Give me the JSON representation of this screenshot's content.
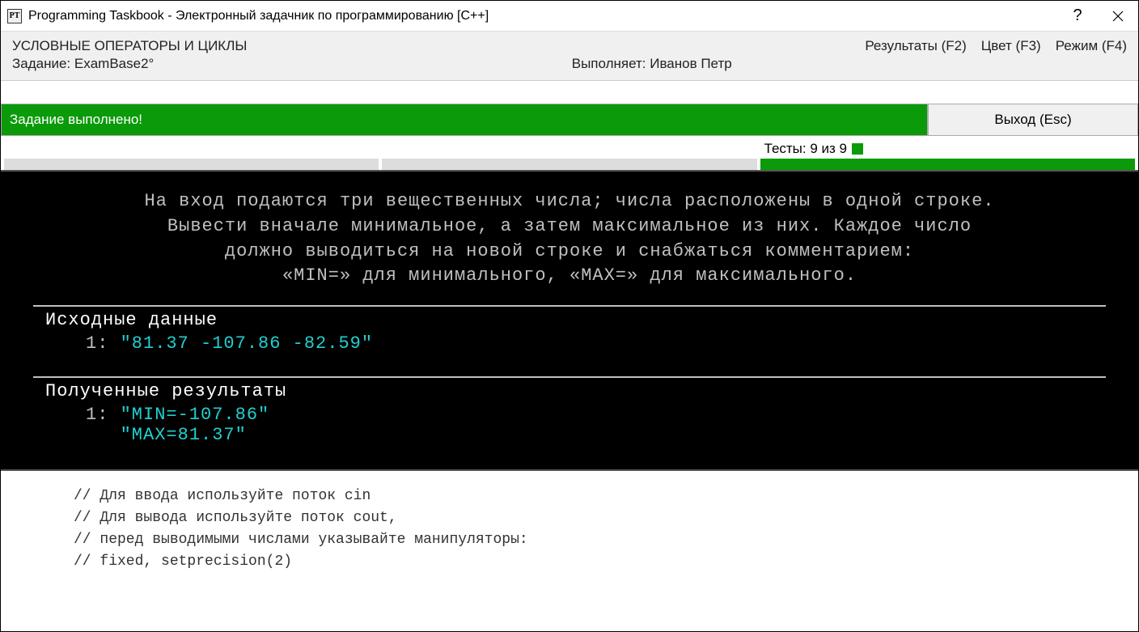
{
  "titlebar": {
    "icon_text": "PT",
    "title": "Programming Taskbook - Электронный задачник по программированию [C++]",
    "help": "?"
  },
  "info": {
    "caption": "УСЛОВНЫЕ ОПЕРАТОРЫ И ЦИКЛЫ",
    "task_label": "Задание: ExamBase2°",
    "user_label": "Выполняет: Иванов Петр"
  },
  "menu": {
    "results": "Результаты (F2)",
    "color": "Цвет (F3)",
    "mode": "Режим (F4)"
  },
  "status": {
    "message": "Задание выполнено!",
    "exit": "Выход (Esc)"
  },
  "tests": {
    "label": "Тесты:  9 из 9"
  },
  "console": {
    "task_line1": "На вход подаются три вещественных числа; числа расположены в одной строке.",
    "task_line2": "Вывести вначале минимальное, а затем максимальное из них. Каждое число",
    "task_line3": "должно выводиться на новой строке и снабжаться комментарием:",
    "task_line4": "«MIN=» для минимального, «MAX=» для максимального.",
    "input_title": "Исходные данные",
    "input_idx": "1: ",
    "input_val": "\"81.37 -107.86 -82.59\"",
    "output_title": "Полученные результаты",
    "output_idx": "1: ",
    "output_val1": "\"MIN=-107.86\"",
    "output_val2": "\"MAX=81.37\""
  },
  "comments": {
    "l1": "// Для ввода используйте поток cin",
    "l2": "// Для вывода используйте поток cout,",
    "l3": "// перед выводимыми числами указывайте манипуляторы:",
    "l4": "// fixed, setprecision(2)"
  }
}
